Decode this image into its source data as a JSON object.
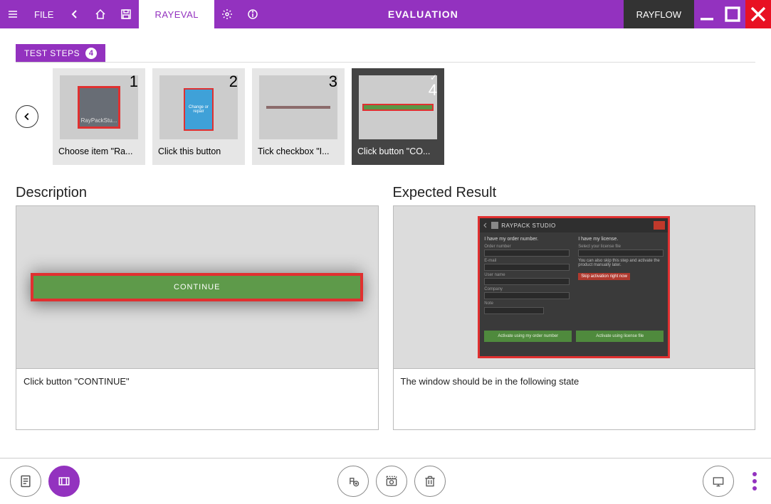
{
  "titlebar": {
    "file_label": "FILE",
    "active_tab": "RAYEVAL",
    "title": "EVALUATION",
    "rayflow": "RAYFLOW"
  },
  "test_steps": {
    "header": "TEST STEPS",
    "count": "4",
    "items": [
      {
        "num": "1",
        "caption": "Choose item \"Ra...",
        "preview_label": "RayPackStu..."
      },
      {
        "num": "2",
        "caption": "Click this button",
        "preview_label": "Change or repair"
      },
      {
        "num": "3",
        "caption": "Tick checkbox \"I..."
      },
      {
        "num": "4",
        "caption": "Click button \"CO...",
        "checked": "✓"
      }
    ]
  },
  "description": {
    "title": "Description",
    "bar_text": "CONTINUE",
    "text": "Click button \"CONTINUE\""
  },
  "expected": {
    "title": "Expected Result",
    "dialog": {
      "title": "RAYPACK STUDIO",
      "left_heading": "I have my order number.",
      "right_heading": "I have my license.",
      "left_labels": [
        "Order number",
        "E-mail",
        "User name",
        "Company",
        "Note"
      ],
      "right_label": "Select your license file",
      "right_hint": "You can also skip this step and activate the product manually later.",
      "red_btn": "Skip activation right now",
      "bottom_left": "Activate using my order number",
      "bottom_right": "Activate using license file"
    },
    "text": "The window should be in the following state"
  },
  "bottom": {
    "doc_btn": "document-view",
    "frames_btn": "frames-view",
    "add_btn": "add-annotation",
    "camera_btn": "capture",
    "delete_btn": "delete",
    "display_btn": "display-mode",
    "more_btn": "more"
  }
}
